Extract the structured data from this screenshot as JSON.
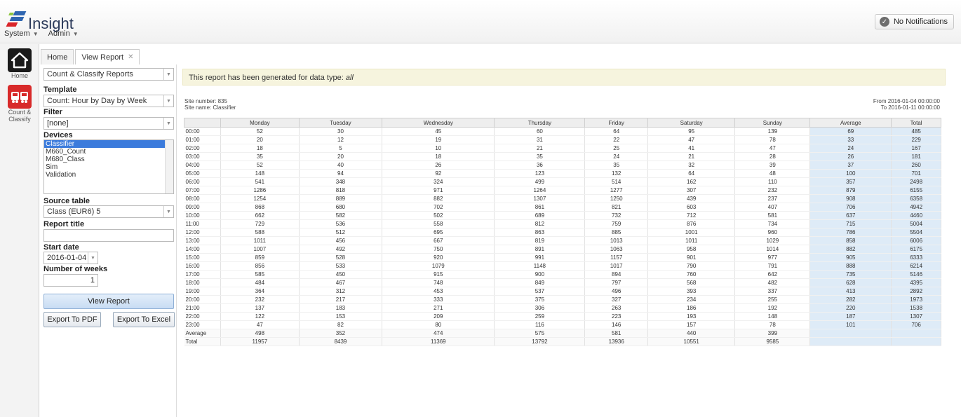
{
  "app": {
    "brand": "Insight",
    "menu": [
      "System",
      "Admin"
    ],
    "notifications_label": "No Notifications"
  },
  "nav": {
    "home_label": "Home",
    "count_label_line1": "Count &",
    "count_label_line2": "Classify"
  },
  "tabs": [
    {
      "label": "Home"
    },
    {
      "label": "View Report"
    }
  ],
  "form": {
    "report_category": "Count & Classify Reports",
    "template_label": "Template",
    "template_value": "Count: Hour by Day by Week",
    "filter_label": "Filter",
    "filter_value": "[none]",
    "devices_label": "Devices",
    "devices": [
      "Classifier",
      "M660_Count",
      "M680_Class",
      "Sim",
      "Validation"
    ],
    "selected_device": "Classifier",
    "source_table_label": "Source table",
    "source_table_value": "Class (EUR6) 5",
    "report_title_label": "Report title",
    "report_title_value": "",
    "start_date_label": "Start date",
    "start_date_value": "2016-01-04",
    "weeks_label": "Number of weeks",
    "weeks_value": "1",
    "view_report_button": "View Report",
    "export_pdf_button": "Export To PDF",
    "export_excel_button": "Export To Excel"
  },
  "report": {
    "banner_prefix": "This report has been generated for data type: ",
    "banner_type": "all",
    "site_number": "Site number: 835",
    "site_name": "Site name: Classifier",
    "from_text": "From 2016-01-04 00:00:00",
    "to_text": "To 2016-01-11 00:00:00",
    "columns": [
      "",
      "Monday",
      "Tuesday",
      "Wednesday",
      "Thursday",
      "Friday",
      "Saturday",
      "Sunday",
      "Average",
      "Total"
    ],
    "rows": [
      [
        "00:00",
        "52",
        "30",
        "45",
        "60",
        "64",
        "95",
        "139",
        "69",
        "485"
      ],
      [
        "01:00",
        "20",
        "12",
        "19",
        "31",
        "22",
        "47",
        "78",
        "33",
        "229"
      ],
      [
        "02:00",
        "18",
        "5",
        "10",
        "21",
        "25",
        "41",
        "47",
        "24",
        "167"
      ],
      [
        "03:00",
        "35",
        "20",
        "18",
        "35",
        "24",
        "21",
        "28",
        "26",
        "181"
      ],
      [
        "04:00",
        "52",
        "40",
        "26",
        "36",
        "35",
        "32",
        "39",
        "37",
        "260"
      ],
      [
        "05:00",
        "148",
        "94",
        "92",
        "123",
        "132",
        "64",
        "48",
        "100",
        "701"
      ],
      [
        "06:00",
        "541",
        "348",
        "324",
        "499",
        "514",
        "162",
        "110",
        "357",
        "2498"
      ],
      [
        "07:00",
        "1286",
        "818",
        "971",
        "1264",
        "1277",
        "307",
        "232",
        "879",
        "6155"
      ],
      [
        "08:00",
        "1254",
        "889",
        "882",
        "1307",
        "1250",
        "439",
        "237",
        "908",
        "6358"
      ],
      [
        "09:00",
        "868",
        "680",
        "702",
        "861",
        "821",
        "603",
        "407",
        "706",
        "4942"
      ],
      [
        "10:00",
        "662",
        "582",
        "502",
        "689",
        "732",
        "712",
        "581",
        "637",
        "4460"
      ],
      [
        "11:00",
        "729",
        "536",
        "558",
        "812",
        "759",
        "876",
        "734",
        "715",
        "5004"
      ],
      [
        "12:00",
        "588",
        "512",
        "695",
        "863",
        "885",
        "1001",
        "960",
        "786",
        "5504"
      ],
      [
        "13:00",
        "1011",
        "456",
        "667",
        "819",
        "1013",
        "1011",
        "1029",
        "858",
        "6006"
      ],
      [
        "14:00",
        "1007",
        "492",
        "750",
        "891",
        "1063",
        "958",
        "1014",
        "882",
        "6175"
      ],
      [
        "15:00",
        "859",
        "528",
        "920",
        "991",
        "1157",
        "901",
        "977",
        "905",
        "6333"
      ],
      [
        "16:00",
        "856",
        "533",
        "1079",
        "1148",
        "1017",
        "790",
        "791",
        "888",
        "6214"
      ],
      [
        "17:00",
        "585",
        "450",
        "915",
        "900",
        "894",
        "760",
        "642",
        "735",
        "5146"
      ],
      [
        "18:00",
        "484",
        "467",
        "748",
        "849",
        "797",
        "568",
        "482",
        "628",
        "4395"
      ],
      [
        "19:00",
        "364",
        "312",
        "453",
        "537",
        "496",
        "393",
        "337",
        "413",
        "2892"
      ],
      [
        "20:00",
        "232",
        "217",
        "333",
        "375",
        "327",
        "234",
        "255",
        "282",
        "1973"
      ],
      [
        "21:00",
        "137",
        "183",
        "271",
        "306",
        "263",
        "186",
        "192",
        "220",
        "1538"
      ],
      [
        "22:00",
        "122",
        "153",
        "209",
        "259",
        "223",
        "193",
        "148",
        "187",
        "1307"
      ],
      [
        "23:00",
        "47",
        "82",
        "80",
        "116",
        "146",
        "157",
        "78",
        "101",
        "706"
      ]
    ],
    "summary_rows": [
      [
        "Average",
        "498",
        "352",
        "474",
        "575",
        "581",
        "440",
        "399",
        "",
        ""
      ],
      [
        "Total",
        "11957",
        "8439",
        "11369",
        "13792",
        "13936",
        "10551",
        "9585",
        "",
        ""
      ]
    ]
  }
}
